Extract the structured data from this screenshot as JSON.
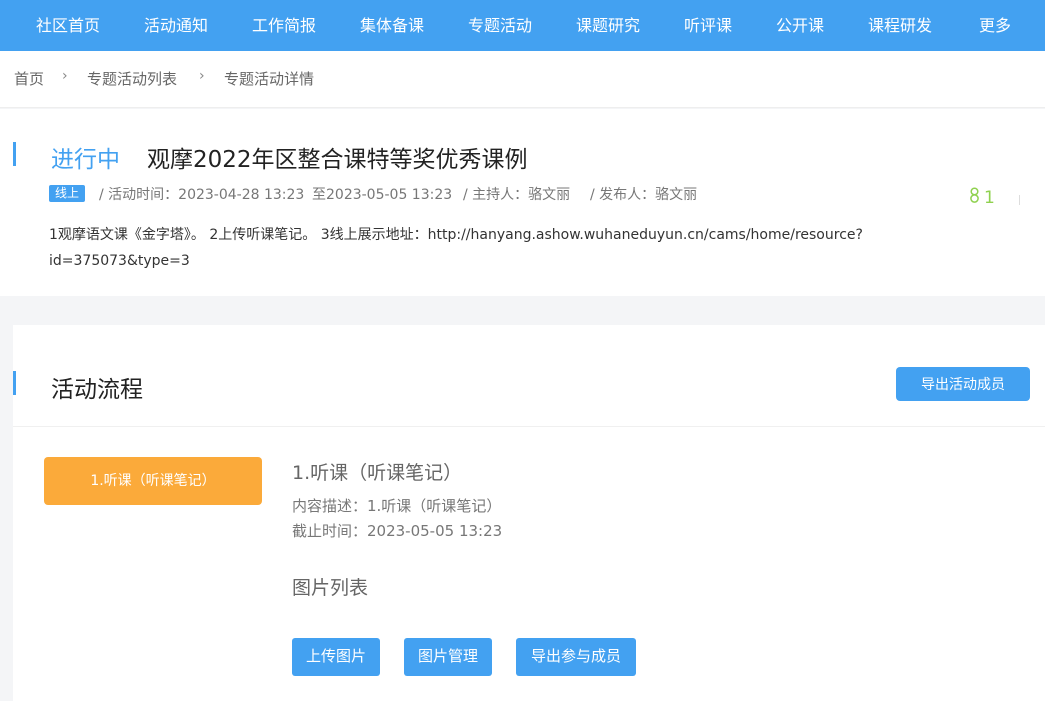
{
  "nav": {
    "items": [
      "社区首页",
      "活动通知",
      "工作简报",
      "集体备课",
      "专题活动",
      "课题研究",
      "听评课",
      "公开课",
      "课程研发",
      "更多"
    ]
  },
  "breadcrumb": {
    "items": [
      "首页",
      "专题活动列表",
      "专题活动详情"
    ],
    "separator": "›"
  },
  "activity": {
    "status": "进行中",
    "title": "观摩2022年区整合课特等奖优秀课例",
    "mode_tag": "线上",
    "time_label": "/ 活动时间：2023-04-28 13:23",
    "time_end": "至2023-05-05 13:23",
    "host": "/ 主持人：骆文丽",
    "publisher": "/ 发布人：骆文丽",
    "like_count": "1",
    "description": "1观摩语文课《金字塔》。 2上传听课笔记。 3线上展示地址：http://hanyang.ashow.wuhaneduyun.cn/cams/home/resource?id=375073&type=3"
  },
  "process": {
    "title": "活动流程",
    "export_members_label": "导出活动成员",
    "step": {
      "tab_label": "1.听课（听课笔记）",
      "title": "1.听课（听课笔记）",
      "content_desc": "内容描述：1.听课（听课笔记）",
      "deadline": "截止时间：2023-05-05 13:23",
      "image_list_title": "图片列表",
      "upload_label": "上传图片",
      "manage_label": "图片管理",
      "export_participants_label": "导出参与成员"
    }
  },
  "colors": {
    "primary": "#43a1f1",
    "step_active": "#fbaa3a",
    "like": "#8fd14f"
  },
  "icons": {
    "like": "user-icon"
  }
}
